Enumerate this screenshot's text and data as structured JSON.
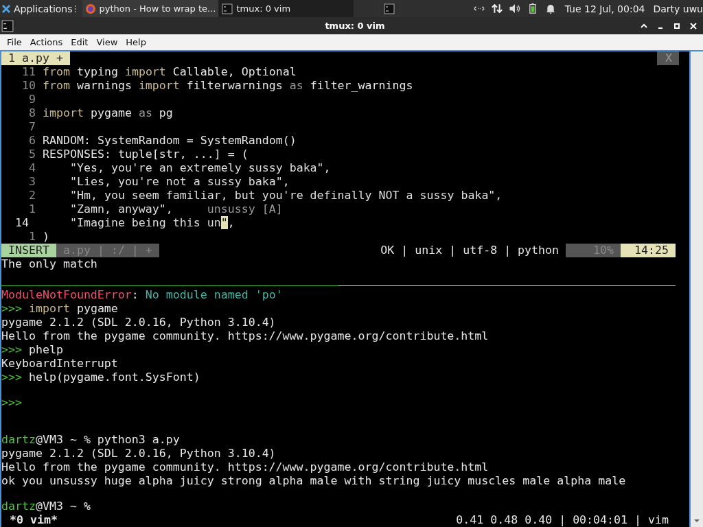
{
  "panel": {
    "apps_label": "Applications",
    "tasks": [
      {
        "kind": "browser",
        "label": "python - How to wrap te...",
        "selected": false
      },
      {
        "kind": "terminal",
        "label": "tmux: 0 vim",
        "selected": true
      },
      {
        "kind": "terminal-icon",
        "selected": false
      }
    ],
    "clock": "Tue 12 Jul, 00:04",
    "user": "Darty uwu"
  },
  "window": {
    "title": "tmux: 0 vim"
  },
  "menu": [
    "File",
    "Actions",
    "Edit",
    "View",
    "Help"
  ],
  "vim": {
    "tab": {
      "label": "1 a.py +",
      "selected": true
    },
    "close": "X",
    "lines": [
      {
        "number": "11",
        "current": false,
        "segments": [
          {
            "kind": "kw",
            "text": "from"
          },
          {
            "kind": "plain",
            "text": " typing "
          },
          {
            "kind": "kw",
            "text": "import"
          },
          {
            "kind": "plain",
            "text": " Callable, Optional"
          }
        ]
      },
      {
        "number": "10",
        "current": false,
        "segments": [
          {
            "kind": "kw",
            "text": "from"
          },
          {
            "kind": "plain",
            "text": " warnings "
          },
          {
            "kind": "kw",
            "text": "import"
          },
          {
            "kind": "plain",
            "text": " filterwarnings "
          },
          {
            "kind": "dim",
            "text": "as"
          },
          {
            "kind": "plain",
            "text": " filter_warnings"
          }
        ]
      },
      {
        "number": "9",
        "current": false
      },
      {
        "number": "8",
        "current": false,
        "segments": [
          {
            "kind": "kw",
            "text": "import"
          },
          {
            "kind": "plain",
            "text": " pygame "
          },
          {
            "kind": "dim",
            "text": "as"
          },
          {
            "kind": "plain",
            "text": " pg"
          }
        ]
      },
      {
        "number": "7",
        "current": false
      },
      {
        "number": "6",
        "current": false,
        "segments": [
          {
            "kind": "plain",
            "text": "RANDOM: SystemRandom = SystemRandom()"
          }
        ]
      },
      {
        "number": "5",
        "current": false,
        "segments": [
          {
            "kind": "plain",
            "text": "RESPONSES: tuple[str, ...] = ("
          }
        ]
      },
      {
        "number": "4",
        "current": false,
        "segments": [
          {
            "kind": "str",
            "text": "    \"Yes, you're an extremely sussy baka\","
          }
        ]
      },
      {
        "number": "3",
        "current": false,
        "segments": [
          {
            "kind": "str",
            "text": "    \"Lies, you're not a sussy baka\","
          }
        ]
      },
      {
        "number": "2",
        "current": false,
        "segments": [
          {
            "kind": "str",
            "text": "    \"Hm, you seem familiar, but you're definally NOT a sussy baka\","
          }
        ]
      },
      {
        "number": "1",
        "current": false,
        "segments": [
          {
            "kind": "str",
            "text": "    \"Zamn, anyway\",     "
          },
          {
            "kind": "dim",
            "text": "unsussy [A]"
          }
        ]
      },
      {
        "number": "14",
        "current": true,
        "segments": [
          {
            "kind": "str",
            "text": "    \"Imagine being this un"
          },
          {
            "kind": "cursor",
            "text": "\""
          },
          {
            "kind": "str",
            "text": ","
          }
        ]
      },
      {
        "number": "1",
        "current": false,
        "segments": [
          {
            "kind": "plain",
            "text": ")"
          }
        ]
      }
    ],
    "status": {
      "mode": "INSERT",
      "file": "a.py | :/ | +",
      "info": "OK | unix | utf-8 | python",
      "percent": "10%",
      "position": "14:25"
    },
    "message": "The only match"
  },
  "repl": [
    {
      "segments": [
        {
          "kind": "error",
          "text": "ModuleNotFoundError"
        },
        {
          "kind": "plain",
          "text": ": "
        },
        {
          "kind": "cyan",
          "text": "No module named 'po'"
        }
      ]
    },
    {
      "segments": [
        {
          "kind": "prompt",
          "text": ">>> "
        },
        {
          "kind": "kw",
          "text": "import"
        },
        {
          "kind": "plain",
          "text": " pygame"
        }
      ]
    },
    {
      "segments": [
        {
          "kind": "plain",
          "text": "pygame 2.1.2 (SDL 2.0.16, Python 3.10.4)"
        }
      ]
    },
    {
      "segments": [
        {
          "kind": "plain",
          "text": "Hello from the pygame community. https://www.pygame.org/contribute.html"
        }
      ]
    },
    {
      "segments": [
        {
          "kind": "prompt",
          "text": ">>> "
        },
        {
          "kind": "plain",
          "text": "phelp"
        }
      ]
    },
    {
      "segments": [
        {
          "kind": "plain",
          "text": "KeyboardInterrupt"
        }
      ]
    },
    {
      "segments": [
        {
          "kind": "prompt",
          "text": ">>> "
        },
        {
          "kind": "plain",
          "text": "help(pygame.font.SysFont)"
        }
      ]
    },
    {
      "segments": [
        {
          "kind": "prompt",
          "text": ">>>"
        }
      ]
    }
  ],
  "shell_runs": [
    {
      "lines": [
        {
          "segments": [
            {
              "kind": "prompt",
              "text": "dartz"
            },
            {
              "kind": "plain",
              "text": "@VM3 ~ % python3 a.py"
            }
          ]
        },
        {
          "segments": [
            {
              "kind": "plain",
              "text": "pygame 2.1.2 (SDL 2.0.16, Python 3.10.4)"
            }
          ]
        },
        {
          "segments": [
            {
              "kind": "plain",
              "text": "Hello from the pygame community. https://www.pygame.org/contribute.html"
            }
          ]
        },
        {
          "segments": [
            {
              "kind": "plain",
              "text": "ok you unsussy huge alpha juicy strong alpha male with string juicy muscles male alpha male"
            }
          ]
        }
      ]
    },
    {
      "lines": [
        {
          "segments": [
            {
              "kind": "prompt",
              "text": "dartz"
            },
            {
              "kind": "plain",
              "text": "@VM3 ~ %"
            }
          ]
        }
      ]
    }
  ],
  "tmux": {
    "window": "*0 vim*",
    "right": "0.41 0.48 0.40 | 00:04:01 | vim"
  }
}
